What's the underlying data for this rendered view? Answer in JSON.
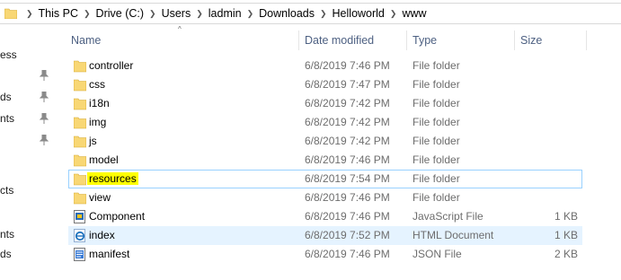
{
  "breadcrumb": [
    "This PC",
    "Drive (C:)",
    "Users",
    "ladmin",
    "Downloads",
    "Helloworld",
    "www"
  ],
  "left_pane_fragments": [
    "ess",
    "ds",
    "nts",
    "cts",
    "nts",
    "ds"
  ],
  "columns": {
    "name": "Name",
    "date": "Date modified",
    "type": "Type",
    "size": "Size"
  },
  "colors": {
    "folder": "#f8d775",
    "highlight": "#ffff00",
    "selection_border": "#99d1ff",
    "hover_bg": "#e5f3ff"
  },
  "files": [
    {
      "name": "controller",
      "date": "6/8/2019 7:46 PM",
      "type": "File folder",
      "size": "",
      "icon": "folder-icon"
    },
    {
      "name": "css",
      "date": "6/8/2019 7:47 PM",
      "type": "File folder",
      "size": "",
      "icon": "folder-icon"
    },
    {
      "name": "i18n",
      "date": "6/8/2019 7:42 PM",
      "type": "File folder",
      "size": "",
      "icon": "folder-icon"
    },
    {
      "name": "img",
      "date": "6/8/2019 7:42 PM",
      "type": "File folder",
      "size": "",
      "icon": "folder-icon"
    },
    {
      "name": "js",
      "date": "6/8/2019 7:42 PM",
      "type": "File folder",
      "size": "",
      "icon": "folder-icon"
    },
    {
      "name": "model",
      "date": "6/8/2019 7:46 PM",
      "type": "File folder",
      "size": "",
      "icon": "folder-icon"
    },
    {
      "name": "resources",
      "date": "6/8/2019 7:54 PM",
      "type": "File folder",
      "size": "",
      "icon": "folder-icon"
    },
    {
      "name": "view",
      "date": "6/8/2019 7:46 PM",
      "type": "File folder",
      "size": "",
      "icon": "folder-icon"
    },
    {
      "name": "Component",
      "date": "6/8/2019 7:46 PM",
      "type": "JavaScript File",
      "size": "1 KB",
      "icon": "javascript-file-icon"
    },
    {
      "name": "index",
      "date": "6/8/2019 7:52 PM",
      "type": "HTML Document",
      "size": "1 KB",
      "icon": "html-file-icon"
    },
    {
      "name": "manifest",
      "date": "6/8/2019 7:46 PM",
      "type": "JSON File",
      "size": "2 KB",
      "icon": "json-file-icon"
    }
  ]
}
